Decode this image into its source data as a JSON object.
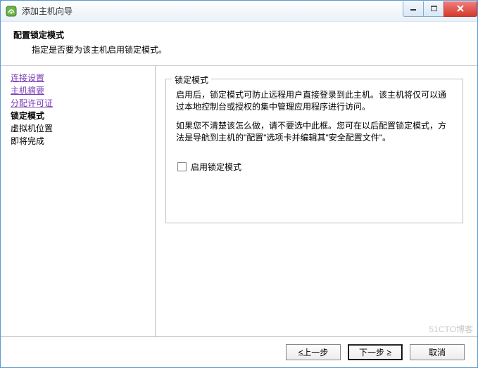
{
  "window": {
    "title": "添加主机向导"
  },
  "header": {
    "title": "配置锁定模式",
    "subtitle": "指定是否要为该主机启用锁定模式。"
  },
  "sidebar": {
    "items": [
      {
        "label": "连接设置",
        "type": "link"
      },
      {
        "label": "主机摘要",
        "type": "link"
      },
      {
        "label": "分配许可证",
        "type": "link"
      },
      {
        "label": "锁定模式",
        "type": "current"
      },
      {
        "label": "虚拟机位置",
        "type": "plain"
      },
      {
        "label": "即将完成",
        "type": "plain"
      }
    ]
  },
  "group": {
    "legend": "锁定模式",
    "para1": "启用后，锁定模式可防止远程用户直接登录到此主机。该主机将仅可以通过本地控制台或授权的集中管理应用程序进行访问。",
    "para2": "如果您不清楚该怎么做，请不要选中此框。您可在以后配置锁定模式，方法是导航到主机的\"配置\"选项卡并编辑其\"安全配置文件\"。",
    "checkbox_label": "启用锁定模式"
  },
  "footer": {
    "back": "≤上一步",
    "next": "下一步 ≥",
    "cancel": "取消"
  },
  "watermark": "51CTO博客"
}
